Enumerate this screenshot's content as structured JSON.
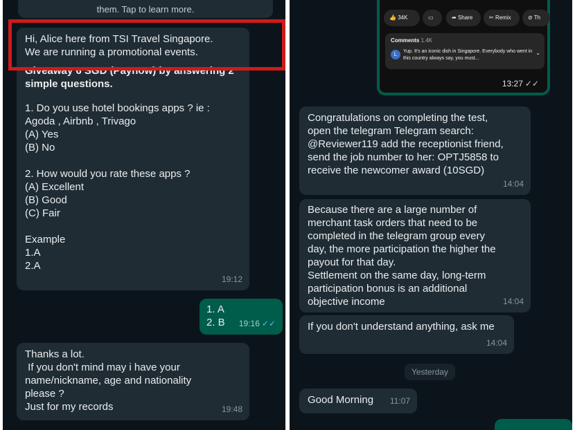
{
  "left": {
    "top_system_text": "them. Tap to learn more.",
    "msg1": {
      "text": "Hi, Alice here from TSI Travel Singapore.\nWe are running a promotional events.",
      "bold": "Giveaway 6 SGD (Paynow) by answering 2\nsimple questions.",
      "body": "1. Do you use hotel bookings apps ? ie :\nAgoda , Airbnb , Trivago\n(A) Yes\n(B) No\n\n2. How would you rate these apps ?\n(A) Excellent\n(B) Good\n(C) Fair\n\nExample\n1.A\n2.A",
      "time": "19:12"
    },
    "reply1": {
      "text": "1. A\n2. B",
      "time": "19:16",
      "ticks": "✓✓"
    },
    "msg2": {
      "text": "Thanks a lot.\n If you don't mind may i have your\nname/nickname, age and nationality\nplease ?\nJust for my records",
      "time": "19:48"
    }
  },
  "right": {
    "yt": {
      "likes": "34K",
      "share": "Share",
      "remix": "Remix",
      "more": "Th",
      "comments_label": "Comments",
      "comments_count": "1.4K",
      "comment_text": "Yup. It's an iconic dish in Singapore.  Everybody who went in this country always say, you must...",
      "avatar_letter": "L",
      "time": "13:27",
      "ticks": "✓✓"
    },
    "msg1": {
      "text": "Congratulations on completing the test,\nopen the telegram Telegram search:\n@Reviewer119 add the receptionist friend,\nsend the job number to her: OPTJ5858 to\nreceive the newcomer award (10SGD)",
      "time": "14:04"
    },
    "msg2": {
      "text": "Because there are a large number of\nmerchant task orders that need to be\ncompleted in the telegram group every\nday, the more participation the higher the\npayout for that day.\nSettlement on the same day, long-term\nparticipation bonus is an additional\nobjective income",
      "time": "14:04"
    },
    "msg3": {
      "text": "If you don't understand anything, ask me",
      "time": "14:04"
    },
    "date_pill": "Yesterday",
    "msg4": {
      "text": "Good Morning",
      "time": "11:07"
    }
  },
  "colors": {
    "background": "#0b141a",
    "incoming_bubble": "#202c33",
    "outgoing_bubble": "#005c4b",
    "highlight_border": "#d11a1a"
  }
}
